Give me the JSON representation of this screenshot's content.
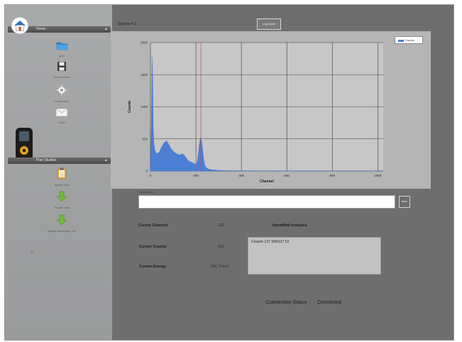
{
  "sidebar": {
    "home_header": "Home",
    "items": [
      {
        "label": "Open",
        "icon": "folder-icon"
      },
      {
        "label": "Save Spectrum",
        "icon": "disk-icon"
      },
      {
        "label": "Configuration",
        "icon": "gear-icon"
      },
      {
        "label": "Email",
        "icon": "envelope-icon"
      }
    ],
    "plan_header": "Plan Studies",
    "plan_items": [
      {
        "label": "Sample Data",
        "icon": "clipboard-icon"
      },
      {
        "label": "Transfer Data",
        "icon": "arrow-down-icon"
      },
      {
        "label": "Validate Identification File",
        "icon": "arrow-down-icon"
      }
    ],
    "footer_number": "10"
  },
  "spectra": {
    "label": "Spectra #",
    "value": "1"
  },
  "log_scale_button": "Log Scale",
  "chart_data": {
    "type": "area",
    "xlabel": "Channel",
    "ylabel": "Counts",
    "xlim": [
      0,
      1024
    ],
    "ylim": [
      0,
      2000
    ],
    "x_ticks": [
      0,
      200,
      400,
      600,
      800,
      1000
    ],
    "y_ticks": [
      0,
      500,
      1000,
      1500,
      2000
    ],
    "legend": "top-right",
    "grid": true,
    "cursor_channel": 222,
    "series": [
      {
        "name": "Counts",
        "color": "#4a7fd4",
        "x": [
          0,
          4,
          7,
          10,
          12,
          15,
          20,
          25,
          30,
          40,
          50,
          60,
          70,
          80,
          90,
          100,
          110,
          120,
          130,
          140,
          150,
          160,
          170,
          180,
          190,
          200,
          205,
          210,
          215,
          220,
          225,
          230,
          235,
          240,
          250,
          260,
          280,
          300,
          320,
          340,
          360,
          400,
          450,
          500,
          600,
          800,
          1000,
          1024
        ],
        "y": [
          0,
          800,
          1780,
          1400,
          700,
          430,
          320,
          280,
          270,
          300,
          380,
          440,
          470,
          420,
          350,
          310,
          280,
          260,
          250,
          270,
          240,
          190,
          150,
          140,
          120,
          100,
          130,
          250,
          410,
          520,
          470,
          320,
          160,
          80,
          40,
          25,
          15,
          10,
          8,
          6,
          5,
          4,
          3,
          2,
          1,
          0,
          0,
          0
        ]
      }
    ]
  },
  "description": {
    "label": "Description",
    "value": "",
    "save_button": "Save"
  },
  "cursor": {
    "channel_label": "Cursor Channel",
    "channel_value": "222",
    "counts_label": "Cursor Counts",
    "counts_value": "403",
    "energy_label": "Cursor Energy",
    "energy_value": "665.74 keV"
  },
  "isotopes": {
    "title": "Identified Isotopes",
    "items": [
      "Cesium 137 SN9127 63"
    ]
  },
  "connection": {
    "label": "Connection Status",
    "value": "Connected"
  }
}
